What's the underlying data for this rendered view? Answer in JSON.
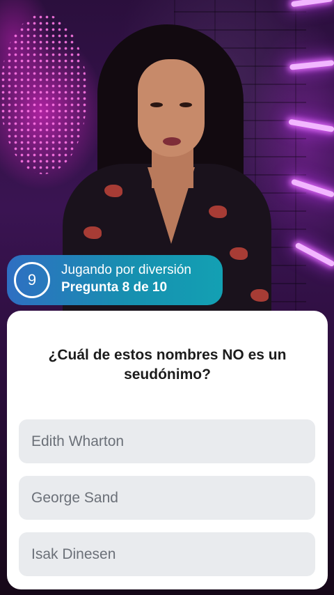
{
  "game": {
    "timer": "9",
    "mode": "Jugando por diversión",
    "progress": "Pregunta 8 de 10"
  },
  "question": {
    "text": "¿Cuál de estos nombres NO es un seudónimo?",
    "options": [
      {
        "label": "Edith Wharton"
      },
      {
        "label": "George Sand"
      },
      {
        "label": "Isak Dinesen"
      }
    ]
  },
  "colors": {
    "pill_start": "#2f6fc2",
    "pill_end": "#13a0b3",
    "card": "#ffffff",
    "option_bg": "#e9ebee",
    "option_text": "#6b7078",
    "question_text": "#1c1c1c"
  }
}
